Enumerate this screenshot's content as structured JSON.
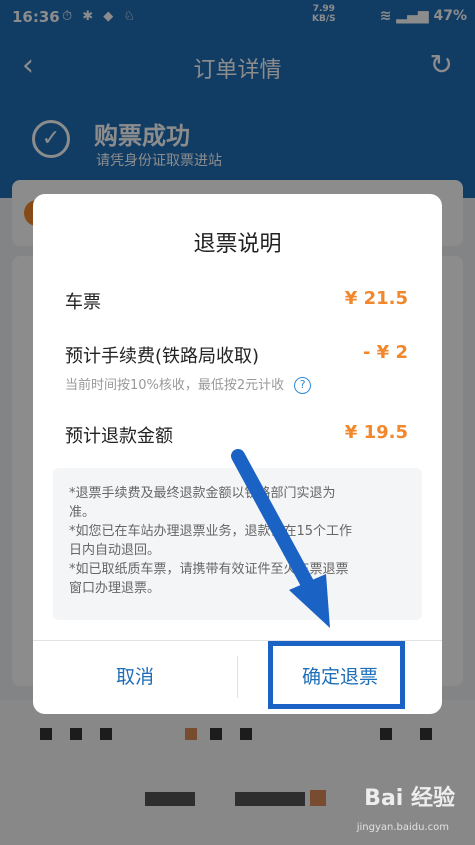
{
  "status_bar": {
    "time": "16:36",
    "speed_value": "7.99",
    "speed_unit": "KB/S",
    "battery": "47%"
  },
  "nav": {
    "title": "订单详情"
  },
  "hero": {
    "title": "购票成功",
    "subtitle": "请凭身份证取票进站"
  },
  "dialog": {
    "title": "退票说明",
    "ticket_label": "车票",
    "ticket_amount": "¥ 21.5",
    "fee_label": "预计手续费(铁路局收取)",
    "fee_amount": "- ¥ 2",
    "fee_hint": "当前时间按10%核收，最低按2元计收",
    "refund_label": "预计退款金额",
    "refund_amount": "¥ 19.5",
    "notes": [
      "*退票手续费及最终退款金额以铁路部门实退为",
      "准。",
      "*如您已在车站办理退票业务，退款会在15个工作",
      "日内自动退回。",
      "*如已取纸质车票，请携带有效证件至火车票退票",
      "窗口办理退票。"
    ],
    "cancel_label": "取消",
    "confirm_label": "确定退票"
  },
  "watermark": {
    "brand": "Bai 经验",
    "url": "jingyan.baidu.com"
  },
  "colors": {
    "primary": "#1f6fb8",
    "accent_orange": "#f2872c",
    "annotation_blue": "#1a62c4"
  }
}
